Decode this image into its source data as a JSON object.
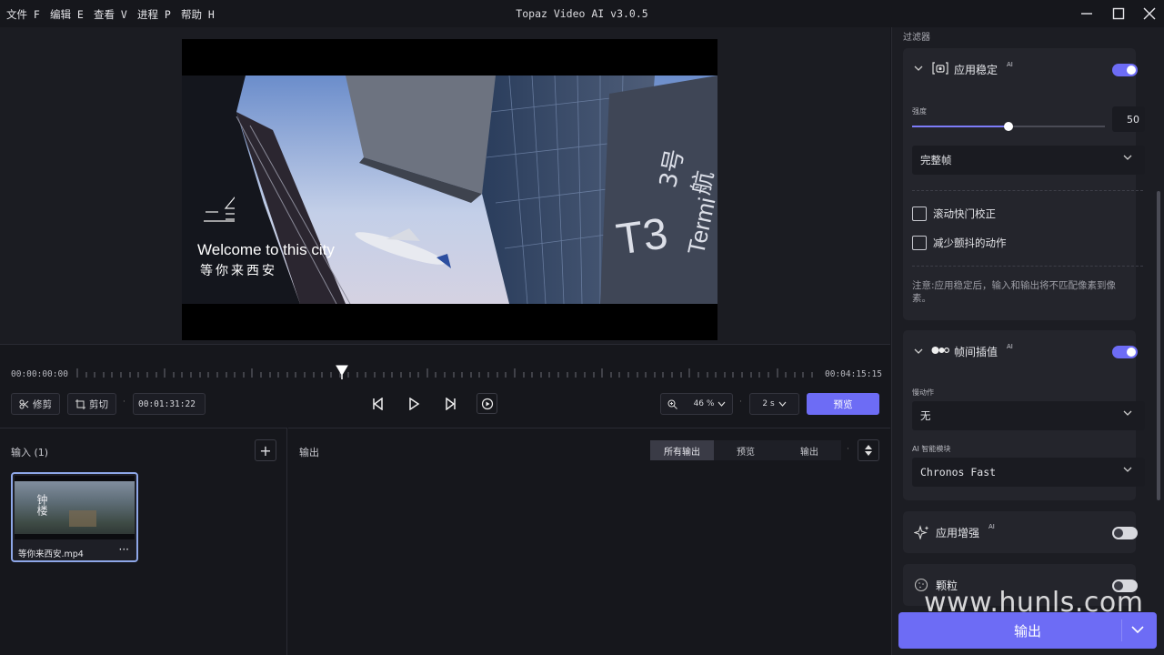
{
  "menu": {
    "file": "文件 F",
    "edit": "编辑 E",
    "view": "查看 V",
    "process": "进程 P",
    "help": "帮助 H"
  },
  "app_title": "Topaz Video AI  v3.0.5",
  "video": {
    "overlay_title": "Welcome to this city",
    "overlay_subtitle": "等你来西安",
    "sign_t3": "T3",
    "sign_cn": "3号航",
    "sign_en": "Termi"
  },
  "timeline": {
    "start_time": "00:00:00:00",
    "end_time": "00:04:15:15",
    "playhead_fraction": 0.36,
    "trim_label": "修剪",
    "crop_label": "剪切",
    "current_time": "00:01:31:22",
    "zoom_value": "46 %",
    "preview_length": "2 s",
    "preview_button": "预览"
  },
  "input_panel": {
    "title": "输入 (1)",
    "add_symbol": "+",
    "file_name": "等你来西安.mp4",
    "more_symbol": "···",
    "thumb_text": "钟楼"
  },
  "output_panel": {
    "title": "输出",
    "tabs": [
      "所有输出",
      "预览",
      "输出"
    ],
    "active_tab": 0
  },
  "sidebar": {
    "filters_label": "过滤器",
    "stabilization": {
      "title": "应用稳定",
      "ai": "AI",
      "enabled": true,
      "strength_label": "强度",
      "strength_value": "50",
      "strength_fraction": 0.5,
      "mode": "完整帧",
      "rolling_shutter": "滚动快门校正",
      "reduce_jitter": "减少颤抖的动作",
      "note": "注意:应用稳定后，输入和输出将不匹配像素到像素。"
    },
    "interpolation": {
      "title": "帧间插值",
      "ai": "AI",
      "enabled": true,
      "slowmo_label": "慢动作",
      "slowmo_value": "无",
      "model_label": "AI 智能模块",
      "model_value": "Chronos Fast"
    },
    "enhancement": {
      "title": "应用增强",
      "ai": "AI",
      "enabled": false
    },
    "grain": {
      "title": "颗粒",
      "enabled": false
    }
  },
  "export_button": "输出",
  "watermark": "www.hunls.com",
  "colors": {
    "accent": "#6d6cf5",
    "background": "#16171c",
    "panel": "#24252c"
  }
}
